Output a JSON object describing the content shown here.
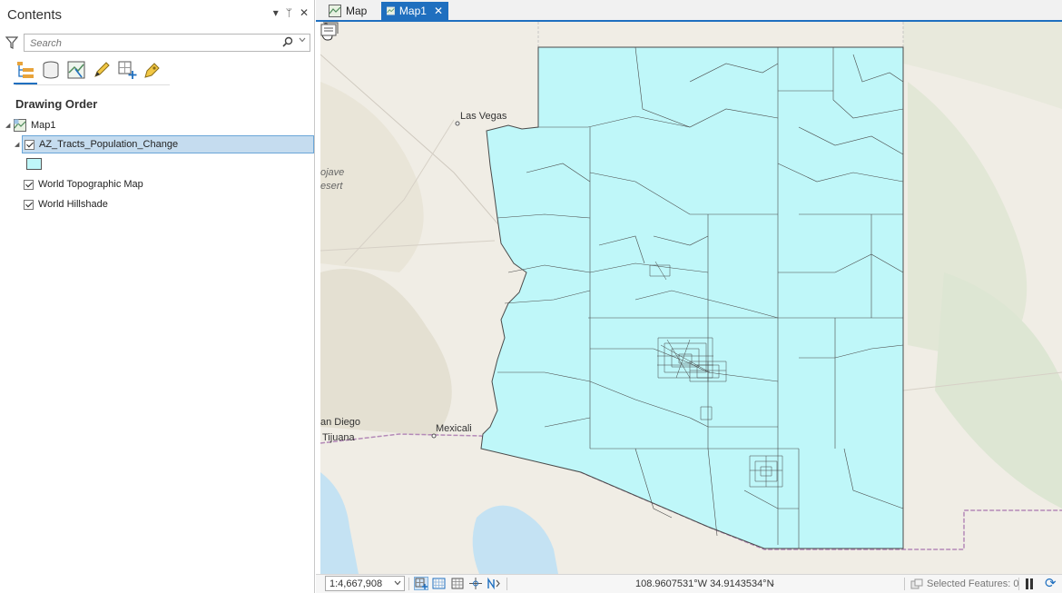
{
  "contents_pane": {
    "title": "Contents",
    "pin_glyph": "▾",
    "autohide_glyph": "ᛘ",
    "close_glyph": "✕",
    "search": {
      "placeholder": "Search",
      "value": ""
    },
    "toolbar_icons": [
      "list-by-drawing-order-icon",
      "list-by-source-icon",
      "list-by-selection-icon",
      "list-by-editing-icon",
      "list-by-snapping-icon",
      "list-by-labeling-icon"
    ],
    "section_heading": "Drawing Order",
    "tree": {
      "map": "Map1",
      "layers": [
        {
          "label": "AZ_Tracts_Population_Change",
          "checked": true,
          "selected": true,
          "symbol_color": "#bff7f9"
        },
        {
          "label": "World Topographic Map",
          "checked": true
        },
        {
          "label": "World Hillshade",
          "checked": true
        }
      ]
    }
  },
  "tabs": [
    {
      "label": "Map",
      "active": false
    },
    {
      "label": "Map1",
      "active": true,
      "close_glyph": "✕"
    }
  ],
  "map": {
    "labels": {
      "las_vegas": "Las Vegas",
      "mojave_1": "ojave",
      "mojave_2": "esert",
      "san_diego": "an Diego",
      "tijuana": "Tijuana",
      "mexicali": "Mexicali"
    },
    "colors": {
      "tracts_fill": "#bff7f9",
      "tracts_stroke": "#4a4a4a",
      "border": "#b48ab8",
      "water": "#c4e2f3"
    }
  },
  "status_bar": {
    "scale": "1:4,667,908",
    "coordinates": "108.9607531°W 34.9143534°N",
    "coord_dropdown_glyph": "⌄",
    "selected_features": "Selected Features: 0",
    "refresh_glyph": "⟳"
  },
  "accent_color": "#1f6fbf"
}
